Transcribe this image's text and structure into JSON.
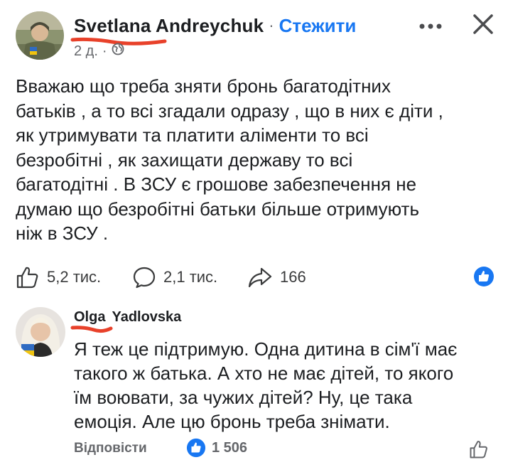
{
  "post": {
    "author": "Svetlana Andreychuk",
    "separator": "·",
    "follow_label": "Стежити",
    "time": "2 д.",
    "meta_separator": "·",
    "privacy_icon": "globe-icon",
    "text_lines": [
      "Вважаю що треба зняти бронь багатодітних",
      "батьків , а то всі згадали одразу , що в них є діти ,",
      "як утримувати та платити аліменти то всі",
      "безробітні , як захищати державу то всі",
      "багатодітні . В ЗСУ є грошове забезпечення не",
      "думаю що безробітні батьки більше отримують",
      "ніж в ЗСУ ."
    ],
    "likes": "5,2 тис.",
    "comments": "2,1 тис.",
    "shares": "166"
  },
  "comment": {
    "author_first": "Olga",
    "author_last": "Yadlovska",
    "text_lines": [
      "Я теж це підтримую. Одна дитина в сім'ї має",
      "такого ж батька. А хто не має дітей, то якого",
      "їм воювати, за чужих дітей? Ну, це така",
      "емоція. Але цю бронь треба знімати."
    ],
    "reply_label": "Відповісти",
    "reaction_count": "1 506"
  },
  "colors": {
    "accent": "#1877f2",
    "annotation": "#e8412a",
    "secondary_text": "#65676b"
  }
}
